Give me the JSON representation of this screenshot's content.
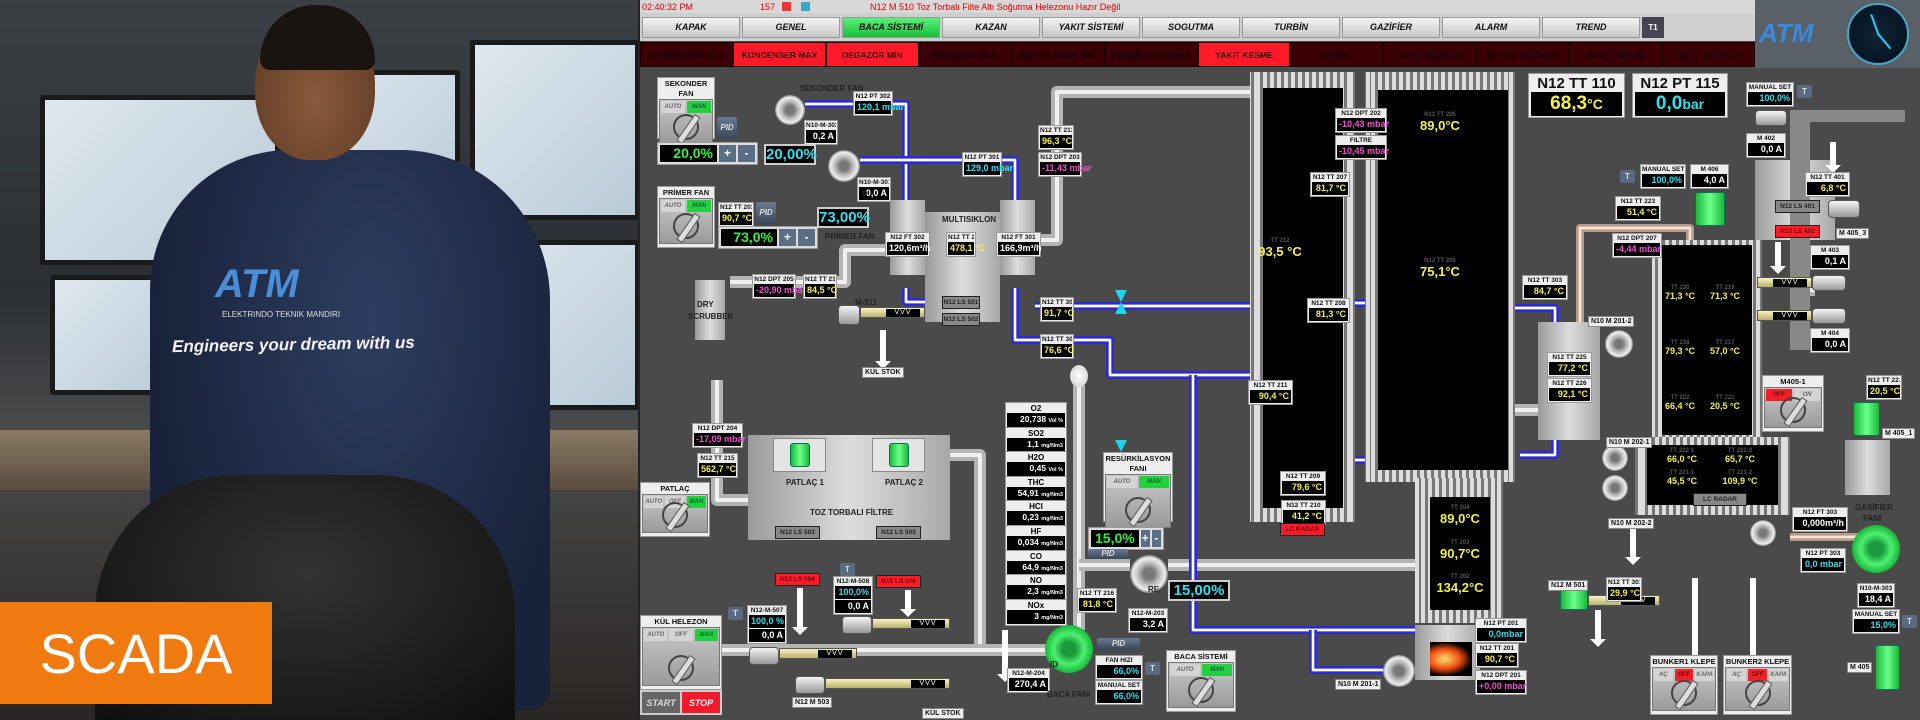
{
  "photo": {
    "badge": "SCADA",
    "shirt_logo": "ATM",
    "shirt_logo_sub": "ELEKTRINDO TEKNIK MANDIRI",
    "shirt_slogan": "Engineers your dream with us"
  },
  "status": {
    "time": "02:40:32 PM",
    "alarm_count": "157",
    "message": "N12 M 510 Toz Torbalı Filte Altı Soğutma Helezonu Hazır Değil"
  },
  "menu": {
    "items": [
      "KAPAK",
      "GENEL",
      "BACA SİSTEMİ",
      "KAZAN",
      "YAKIT SİSTEMİ",
      "SOGUTMA",
      "TURBİN",
      "GAZİFİER",
      "ALARM",
      "TREND"
    ],
    "active": "BACA SİSTEMİ",
    "t1": "T1"
  },
  "alarms": [
    {
      "label": "KONDENSER MIN",
      "active": false
    },
    {
      "label": "KONDENSER MAX",
      "active": true
    },
    {
      "label": "DEGAZOR MIN",
      "active": true
    },
    {
      "label": "DEGAZOR MAX",
      "active": false
    },
    {
      "label": "BUHAR DRAM MIN",
      "active": false
    },
    {
      "label": "BUHAR DRAM MAX",
      "active": false
    },
    {
      "label": "YAKIT KESME",
      "active": true
    },
    {
      "label": "BASINÇ",
      "active": false
    },
    {
      "label": "OCAK SICAKLIK",
      "active": false
    },
    {
      "label": "BUHAR SICAKLIK",
      "active": false
    },
    {
      "label": "BACA VAKUM",
      "active": false
    },
    {
      "label": "YAKIT SICAKLIK",
      "active": false
    }
  ],
  "brand": {
    "logo": "ATM"
  },
  "colors": {
    "active_menu": "#18c03a",
    "alarm_on": "#ff1a2a",
    "alarm_off": "#3a0006",
    "temp": "#f4f04a",
    "pressure": "#2ee0f0",
    "diff_pressure": "#f050d0",
    "water_pipe": "#2a2ad8",
    "motor_on": "#22d040"
  },
  "big_displays": [
    {
      "tag": "N12 TT 110",
      "value": "68,3",
      "unit": "°C",
      "color": "yellow"
    },
    {
      "tag": "N12 PT 115",
      "value": "0,0",
      "unit": "bar",
      "color": "cyan"
    }
  ],
  "instruments": [
    {
      "tag": "N12 PT 302",
      "value": "120,1 mbar",
      "color": "cyan"
    },
    {
      "tag": "N10-M-302",
      "value": "0,2 A",
      "color": "white"
    },
    {
      "tag": "N10-M-301",
      "value": "0,0 A",
      "color": "white"
    },
    {
      "tag": "N12 PT 301",
      "value": "129,0 mbar",
      "color": "cyan"
    },
    {
      "tag": "N12 TT 213",
      "value": "96,3 °C",
      "color": "yellow"
    },
    {
      "tag": "N12 DPT 203",
      "value": "-11,43 mbar",
      "color": "magenta"
    },
    {
      "tag": "N12 TT 203",
      "value": "90,7 °C",
      "color": "yellow"
    },
    {
      "tag": "N12 FT 302",
      "value": "120,6m³/h",
      "color": "white"
    },
    {
      "tag": "N12 TT 214",
      "value": "478,1 °C",
      "color": "yellow"
    },
    {
      "tag": "N12 FT 301",
      "value": "166,9m³/h",
      "color": "white"
    },
    {
      "tag": "N12 DPT 205",
      "value": "-20,90 mbar",
      "color": "magenta"
    },
    {
      "tag": "N12 TT 214-1",
      "value": "84,5 °C",
      "color": "yellow"
    },
    {
      "tag": "N12 TT 302",
      "value": "91,7 °C",
      "color": "yellow"
    },
    {
      "tag": "N12 TT 301",
      "value": "76,6 °C",
      "color": "yellow"
    },
    {
      "tag": "N12 DPT 202",
      "value": "-10,43 mbar",
      "color": "magenta"
    },
    {
      "tag": "FILTRE",
      "value": "-10,45 mbar",
      "color": "magenta"
    },
    {
      "tag": "N12 TT 207",
      "value": "81,7 °C",
      "color": "yellow"
    },
    {
      "tag": "N12 TT 208",
      "value": "81,3 °C",
      "color": "yellow"
    },
    {
      "tag": "N12 TT 211",
      "value": "90,4 °C",
      "color": "yellow"
    },
    {
      "tag": "N12 TT 209",
      "value": "79,6 °C",
      "color": "yellow"
    },
    {
      "tag": "N12 TT 210",
      "value": "41,2 °C",
      "color": "yellow"
    },
    {
      "tag": "N12 TT 223",
      "value": "51,4 °C",
      "color": "yellow"
    },
    {
      "tag": "N12 DPT 207",
      "value": "-4,44 mbar",
      "color": "magenta"
    },
    {
      "tag": "N12 TT 303",
      "value": "84,7 °C",
      "color": "yellow"
    },
    {
      "tag": "N12 TT 225",
      "value": "77,2 °C",
      "color": "yellow"
    },
    {
      "tag": "N12 TT 226",
      "value": "92,1 °C",
      "color": "yellow"
    },
    {
      "tag": "MANUAL SET",
      "value": "100,0%",
      "color": "cyan"
    },
    {
      "tag": "M 402",
      "value": "0,0 A",
      "color": "white"
    },
    {
      "tag": "MANUAL SET",
      "value": "100,0%",
      "color": "cyan"
    },
    {
      "tag": "M 406",
      "value": "4,0 A",
      "color": "white"
    },
    {
      "tag": "N12 TT 401",
      "value": "6,8 °C",
      "color": "yellow"
    },
    {
      "tag": "M 403",
      "value": "0,1 A",
      "color": "white"
    },
    {
      "tag": "M 404",
      "value": "0,0 A",
      "color": "white"
    },
    {
      "tag": "N12 TT 221",
      "value": "20,5 °C",
      "color": "yellow"
    },
    {
      "tag": "N12 FT 303",
      "value": "0,000m³/h",
      "color": "white"
    },
    {
      "tag": "N12 PT 303",
      "value": "0,0 mbar",
      "color": "cyan"
    },
    {
      "tag": "N10-M-303",
      "value": "18,4 A",
      "color": "white"
    },
    {
      "tag": "MANUAL SET",
      "value": "15,0%",
      "color": "cyan"
    },
    {
      "tag": "N12 TT 301",
      "value": "29,9 °C",
      "color": "yellow"
    },
    {
      "tag": "N12 PT 201",
      "value": "0,0mbar",
      "color": "cyan"
    },
    {
      "tag": "N12 TT 201",
      "value": "90,7 °C",
      "color": "yellow"
    },
    {
      "tag": "N12 DPT 201",
      "value": "+0,00 mbar",
      "color": "magenta"
    },
    {
      "tag": "N12 TT 216",
      "value": "81,8 °C",
      "color": "yellow"
    },
    {
      "tag": "N12-M-203",
      "value": "3,2 A",
      "color": "white"
    },
    {
      "tag": "N12-M-204",
      "value": "270,4 A",
      "color": "white"
    },
    {
      "tag": "FAN HIZI",
      "value": "66,0%",
      "color": "cyan"
    },
    {
      "tag": "MANUAL SET",
      "value": "66,0%",
      "color": "cyan"
    },
    {
      "tag": "N12 DPT 204",
      "value": "-17,09 mbar",
      "color": "magenta"
    },
    {
      "tag": "N12 TT 215",
      "value": "562,7 °C",
      "color": "yellow"
    },
    {
      "tag": "N12-M-508",
      "value": "100,0%",
      "value2": "0,0 A",
      "color": "cyan"
    },
    {
      "tag": "N12-M-507",
      "value": "100,0 %",
      "value2": "0,0 A",
      "color": "cyan"
    }
  ],
  "column_readings": [
    {
      "tag": "TT 212",
      "value": "93,5 °C"
    },
    {
      "tag": "N12 TT 206",
      "value": "89,0°C"
    },
    {
      "tag": "N12 TT 205",
      "value": "75,1°C"
    },
    {
      "tag": "TT 204",
      "value": "89,0°C"
    },
    {
      "tag": "TT 203",
      "value": "90,7°C"
    },
    {
      "tag": "TT 202",
      "value": "134,2°C"
    },
    {
      "tag": "TT 220",
      "value": "71,3 °C"
    },
    {
      "tag": "TT 219",
      "value": "71,3 °C"
    },
    {
      "tag": "TT 218",
      "value": "79,3 °C"
    },
    {
      "tag": "TT 217",
      "value": "57,0 °C"
    },
    {
      "tag": "TT 222",
      "value": "66,4 °C"
    },
    {
      "tag": "TT 221",
      "value": "20,5 °C"
    },
    {
      "tag": "TT 222-1",
      "value": "66,0 °C"
    },
    {
      "tag": "TT 222-2",
      "value": "65,7 °C"
    },
    {
      "tag": "TT 221-1",
      "value": "45,5 °C"
    },
    {
      "tag": "TT 221-2",
      "value": "109,9 °C"
    }
  ],
  "emissions": [
    {
      "name": "O2",
      "value": "20,738",
      "unit": "Vol %"
    },
    {
      "name": "SO2",
      "value": "1,1",
      "unit": "mg/Nm3"
    },
    {
      "name": "H2O",
      "value": "0,45",
      "unit": "Vol %"
    },
    {
      "name": "THC",
      "value": "54,91",
      "unit": "mg/Nm3"
    },
    {
      "name": "HCl",
      "value": "0,23",
      "unit": "mg/Nm3"
    },
    {
      "name": "HF",
      "value": "0,034",
      "unit": "mg/Nm3"
    },
    {
      "name": "CO",
      "value": "64,9",
      "unit": "mg/Nm3"
    },
    {
      "name": "NO",
      "value": "2,3",
      "unit": "mg/Nm3"
    },
    {
      "name": "NOx",
      "value": "3",
      "unit": "mg/Nm3"
    }
  ],
  "tags": [
    "N10 M 201-2",
    "N10 M 202-1",
    "N10 M 202-2",
    "N10 M 201-1",
    "M 405_3",
    "M 405_1",
    "M 405",
    "N12 M 501",
    "N12 M 503",
    "KÜL STOK",
    "KÜL STOK"
  ],
  "texts": [
    "SEKONDER FAN",
    "PRİMER FAN",
    "MULTISIKLON",
    "DRY",
    "SCRUBBER",
    "TOZ TORBALI FİLTRE",
    "BACA FANI",
    "GASİFİER",
    "FANI",
    "M-511",
    "P",
    "RE",
    "ID",
    "PATLAÇ 1",
    "PATLAÇ 2"
  ],
  "chips": [
    {
      "label": "N12 LS 501",
      "state": "grey"
    },
    {
      "label": "N12 LS 502",
      "state": "grey"
    },
    {
      "label": "N12 LS 503",
      "state": "grey"
    },
    {
      "label": "N12 LS 505",
      "state": "grey"
    },
    {
      "label": "N12 LS 504",
      "state": "red"
    },
    {
      "label": "N12 LS 506",
      "state": "red"
    },
    {
      "label": "N12 LS 401",
      "state": "grey"
    },
    {
      "label": "N12 LS 402",
      "state": "red"
    },
    {
      "label": "LC RADAR",
      "state": "red"
    },
    {
      "label": "LC RADAR",
      "state": "grey"
    }
  ],
  "selectors": [
    {
      "title": "SEKONDER FAN",
      "options": [
        "AUTO",
        "MAN"
      ],
      "selected": "MAN"
    },
    {
      "title": "PRİMER FAN",
      "options": [
        "AUTO",
        "MAN"
      ],
      "selected": "MAN"
    },
    {
      "title": "RESÜRKİLASYON FANI",
      "options": [
        "AUTO",
        "MAN"
      ],
      "selected": "MAN"
    },
    {
      "title": "BACA SİSTEMİ",
      "options": [
        "AUTO",
        "MAN"
      ],
      "selected": "MAN"
    },
    {
      "title": "PATLAÇ",
      "options": [
        "AUTO",
        "OFF",
        "MAN"
      ],
      "selected": "MAN"
    },
    {
      "title": "KÜL HELEZON",
      "options": [
        "AUTO",
        "OFF",
        "MAN"
      ],
      "selected": "MAN"
    },
    {
      "title": "M405-1",
      "options": [
        "OFF",
        "ON"
      ],
      "selected": "OFF"
    },
    {
      "title": "BUNKER1 KLEPE",
      "options": [
        "AÇ",
        "OFF",
        "KAPA"
      ],
      "selected": "OFF"
    },
    {
      "title": "BUNKER2 KLEPE",
      "options": [
        "AÇ",
        "OFF",
        "KAPA"
      ],
      "selected": "OFF"
    }
  ],
  "kul_helezon_buttons": {
    "start": "START",
    "stop": "STOP"
  },
  "setpoints": [
    {
      "value": "20,0%",
      "plus": "+",
      "minus": "-"
    },
    {
      "value": "73,0%",
      "plus": "+",
      "minus": "-"
    },
    {
      "value": "15,0%",
      "plus": "+",
      "minus": "-"
    }
  ],
  "fan_outputs": [
    "20,00%",
    "73,00%",
    "15,00%"
  ],
  "pid_label": "PID",
  "t_label": "T",
  "screw_label": "VVV"
}
